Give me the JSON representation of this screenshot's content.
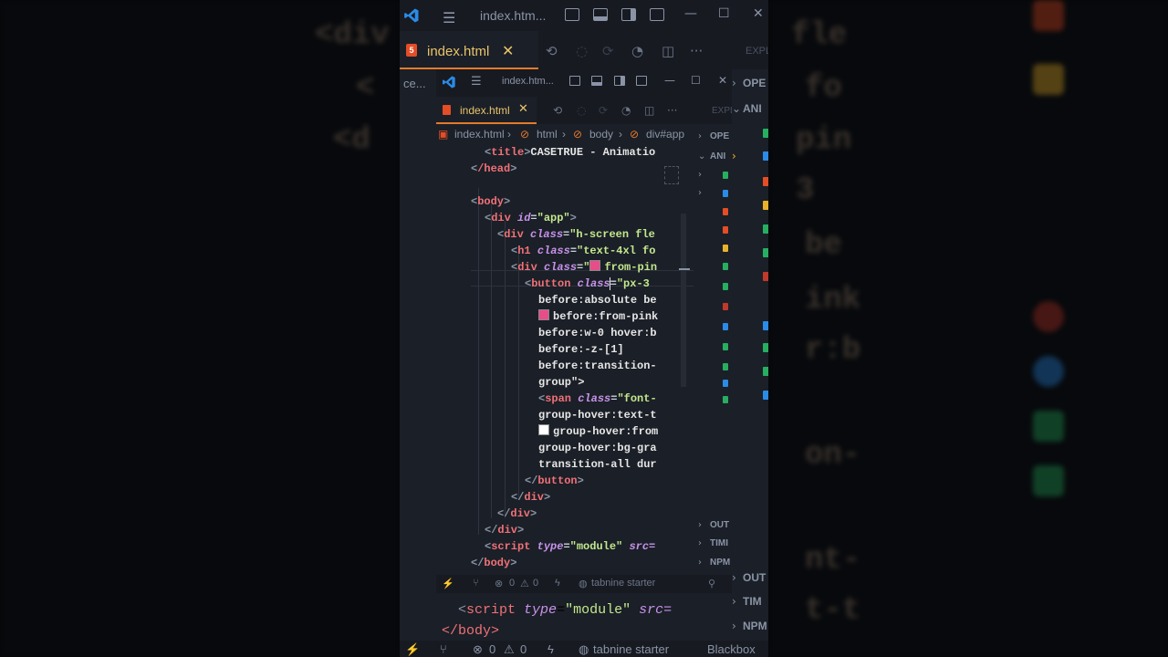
{
  "outer": {
    "window_title": "index.htm...",
    "tab_label": "index.html",
    "explorer_label": "EXPL",
    "sidebar": [
      {
        "label": "OPE"
      },
      {
        "label": "ANI"
      }
    ],
    "sidebar_bottom": [
      {
        "label": "OUT"
      },
      {
        "label": "TIM"
      },
      {
        "label": "NPM"
      }
    ],
    "left_stub": "ce...",
    "code_tail": {
      "closing_div": "</div>",
      "script_tag": "script",
      "script_attr": "type",
      "script_val": "\"module\"",
      "script_src": "src=",
      "closing_body": "</body>"
    },
    "status": {
      "problems": "0",
      "warnings": "0",
      "tabnine": "tabnine starter",
      "blackbox": "Blackbox"
    }
  },
  "inner": {
    "window_title": "index.htm...",
    "tab_label": "index.html",
    "explorer_label": "EXPL",
    "breadcrumb": [
      "index.html",
      "html",
      "body",
      "div#app"
    ],
    "sidebar": [
      {
        "label": "OPE"
      },
      {
        "label": "ANI"
      }
    ],
    "sidebar_bottom": [
      {
        "label": "OUT"
      },
      {
        "label": "TIMI"
      },
      {
        "label": "NPM"
      }
    ],
    "status": {
      "problems": "0",
      "warnings": "0",
      "tabnine": "tabnine starter"
    },
    "code": {
      "title_text": "CASETRUE - Animatio",
      "tag_title": "title",
      "tag_head": "/head",
      "tag_body": "body",
      "app_id": "\"app\"",
      "div_class_1": "\"h-screen fle",
      "h1_class": "\"text-4xl fo",
      "div_class_2": "from-pin",
      "button_class": "\"px-3 ",
      "b1": "before:absolute be",
      "b2": "before:from-pink",
      "b3": "before:w-0 hover:b",
      "b4": "before:-z-[1]",
      "b5": "before:transition-",
      "b6": "group\">",
      "span_class": "\"font-",
      "s1": "group-hover:text-t",
      "s2": "group-hover:from",
      "s3": "group-hover:bg-gra",
      "s4": "transition-all dur",
      "script_val": "\"module\"",
      "script_src": "src="
    }
  },
  "colors": {
    "accent": "#e47a2b",
    "pink_swatch": "#e84d8a",
    "white_swatch": "#ffffff",
    "vscode_blue": "#2b8be6"
  },
  "icons": [
    "vscode-logo-icon",
    "menu-icon",
    "close-icon",
    "layout-icon",
    "split-editor-icon",
    "more-icon",
    "chevron-right-icon",
    "branch-icon",
    "error-icon",
    "warning-icon"
  ]
}
